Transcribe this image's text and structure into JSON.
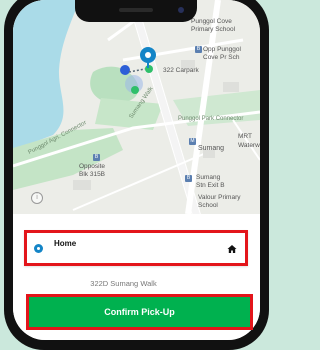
{
  "status_bar": {
    "time": ""
  },
  "map": {
    "labels": {
      "punggol_cove_primary": "Punggol Cove\nPrimary School",
      "opp_punggol_cove": "Opp Punggol\nCove Pr Sch",
      "carpark": "322 Carpark",
      "punggol_park_connector": "Punggol Park Connector",
      "sumang_walk": "Sumang Walk",
      "punggol_agri_connector": "Punggol Agri. Connector",
      "opposite_blk": "Opposite\nBlk 315B",
      "sumang": "Sumang",
      "mrt": "MRT",
      "waterway": "Waterway",
      "sumang_stn_exit": "Sumang\nStn Exit B",
      "valour_primary": "Valour Primary\nSchool"
    },
    "info_icon": "i"
  },
  "pickup": {
    "location_label": "Home",
    "address": "322D Sumang Walk"
  },
  "confirm_button": {
    "label": "Confirm Pick-Up"
  },
  "colors": {
    "brand_green": "#00b14f",
    "highlight_red": "#e3151b",
    "pin_blue": "#1485c7",
    "water": "#aadbe8",
    "park": "#b9e0bf"
  }
}
